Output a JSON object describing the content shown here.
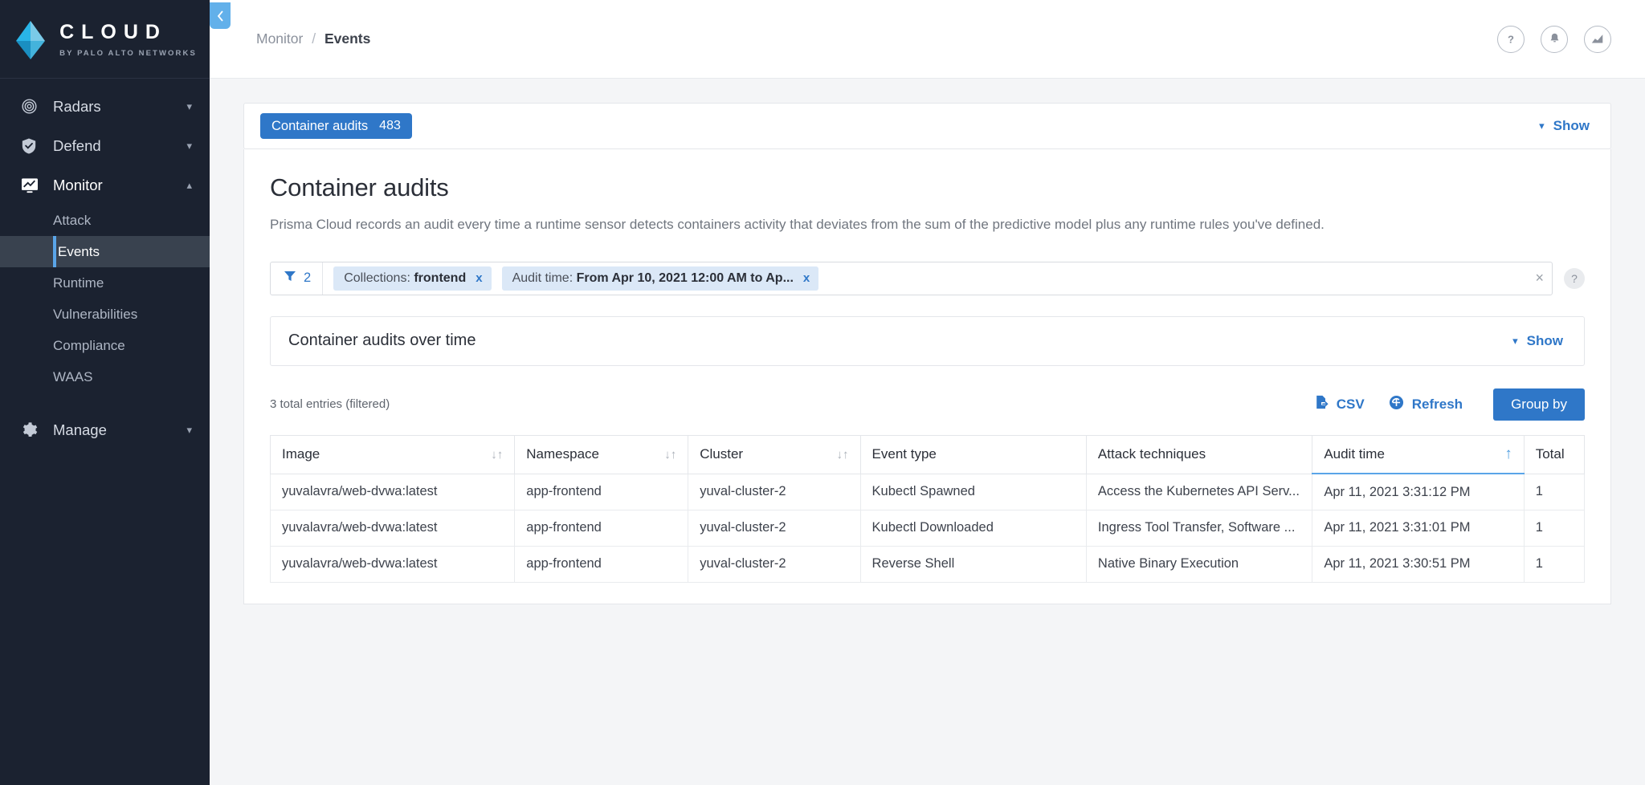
{
  "sidebar": {
    "logo": {
      "word": "CLOUD",
      "sub": "BY PALO ALTO NETWORKS",
      "icon": "prisma-cloud-logo-icon"
    },
    "collapse_icon": "chevron-left-icon",
    "groups": [
      {
        "label": "Radars",
        "icon": "radar-icon",
        "chevron": "chevron-down-icon",
        "expanded": false
      },
      {
        "label": "Defend",
        "icon": "shield-check-icon",
        "chevron": "chevron-down-icon",
        "expanded": false
      },
      {
        "label": "Monitor",
        "icon": "monitor-screen-icon",
        "chevron": "chevron-up-icon",
        "expanded": true
      },
      {
        "label": "Manage",
        "icon": "gear-icon",
        "chevron": "chevron-down-icon",
        "expanded": false
      }
    ],
    "monitor_items": [
      {
        "label": "Attack",
        "selected": false
      },
      {
        "label": "Events",
        "selected": true
      },
      {
        "label": "Runtime",
        "selected": false
      },
      {
        "label": "Vulnerabilities",
        "selected": false
      },
      {
        "label": "Compliance",
        "selected": false
      },
      {
        "label": "WAAS",
        "selected": false
      }
    ]
  },
  "topbar": {
    "breadcrumb_parent": "Monitor",
    "breadcrumb_sep": "/",
    "breadcrumb_current": "Events",
    "icons": [
      {
        "name": "help-icon",
        "glyph": "?"
      },
      {
        "name": "notifications-bell-icon",
        "glyph": "⬤"
      },
      {
        "name": "analytics-chart-icon",
        "glyph": "⬤"
      }
    ]
  },
  "tabs": {
    "active_tab_label": "Container audits",
    "active_tab_count": "483",
    "show_label": "Show",
    "show_chevron": "chevron-down-icon"
  },
  "panel": {
    "title": "Container audits",
    "description": "Prisma Cloud records an audit every time a runtime sensor detects containers activity that deviates from the sum of the predictive model plus any runtime rules you've defined."
  },
  "filters": {
    "filter_icon": "funnel-icon",
    "count": "2",
    "chips": [
      {
        "label": "Collections:",
        "value": "frontend",
        "remove": "x"
      },
      {
        "label": "Audit time:",
        "value": "From Apr 10, 2021 12:00 AM to Ap...",
        "remove": "x"
      }
    ],
    "clear_all": "×",
    "help": "?"
  },
  "over_time": {
    "title": "Container audits over time",
    "show_label": "Show",
    "show_chevron": "chevron-down-icon"
  },
  "toolbar": {
    "entries": "3 total entries (filtered)",
    "csv_label": "CSV",
    "csv_icon": "csv-export-icon",
    "refresh_label": "Refresh",
    "refresh_icon": "refresh-icon",
    "group_by_label": "Group by"
  },
  "table": {
    "columns": [
      {
        "label": "Image",
        "sortable": true,
        "sorted": false
      },
      {
        "label": "Namespace",
        "sortable": true,
        "sorted": false
      },
      {
        "label": "Cluster",
        "sortable": true,
        "sorted": false
      },
      {
        "label": "Event type",
        "sortable": false,
        "sorted": false
      },
      {
        "label": "Attack techniques",
        "sortable": false,
        "sorted": false
      },
      {
        "label": "Audit time",
        "sortable": true,
        "sorted": true,
        "sort_dir": "asc"
      },
      {
        "label": "Total",
        "sortable": false,
        "sorted": false
      }
    ],
    "rows": [
      {
        "image": "yuvalavra/web-dvwa:latest",
        "namespace": "app-frontend",
        "cluster": "yuval-cluster-2",
        "event_type": "Kubectl Spawned",
        "attack_techniques": "Access the Kubernetes API Serv...",
        "audit_time": "Apr 11, 2021 3:31:12 PM",
        "total": "1"
      },
      {
        "image": "yuvalavra/web-dvwa:latest",
        "namespace": "app-frontend",
        "cluster": "yuval-cluster-2",
        "event_type": "Kubectl Downloaded",
        "attack_techniques": "Ingress Tool Transfer, Software ...",
        "audit_time": "Apr 11, 2021 3:31:01 PM",
        "total": "1"
      },
      {
        "image": "yuvalavra/web-dvwa:latest",
        "namespace": "app-frontend",
        "cluster": "yuval-cluster-2",
        "event_type": "Reverse Shell",
        "attack_techniques": "Native Binary Execution",
        "audit_time": "Apr 11, 2021 3:30:51 PM",
        "total": "1"
      }
    ]
  },
  "colors": {
    "sidebar_bg": "#1b2230",
    "accent_blue": "#2f77c8",
    "light_blue": "#62b0ea",
    "chip_bg": "#dbe8f7",
    "page_bg": "#f4f5f7"
  }
}
